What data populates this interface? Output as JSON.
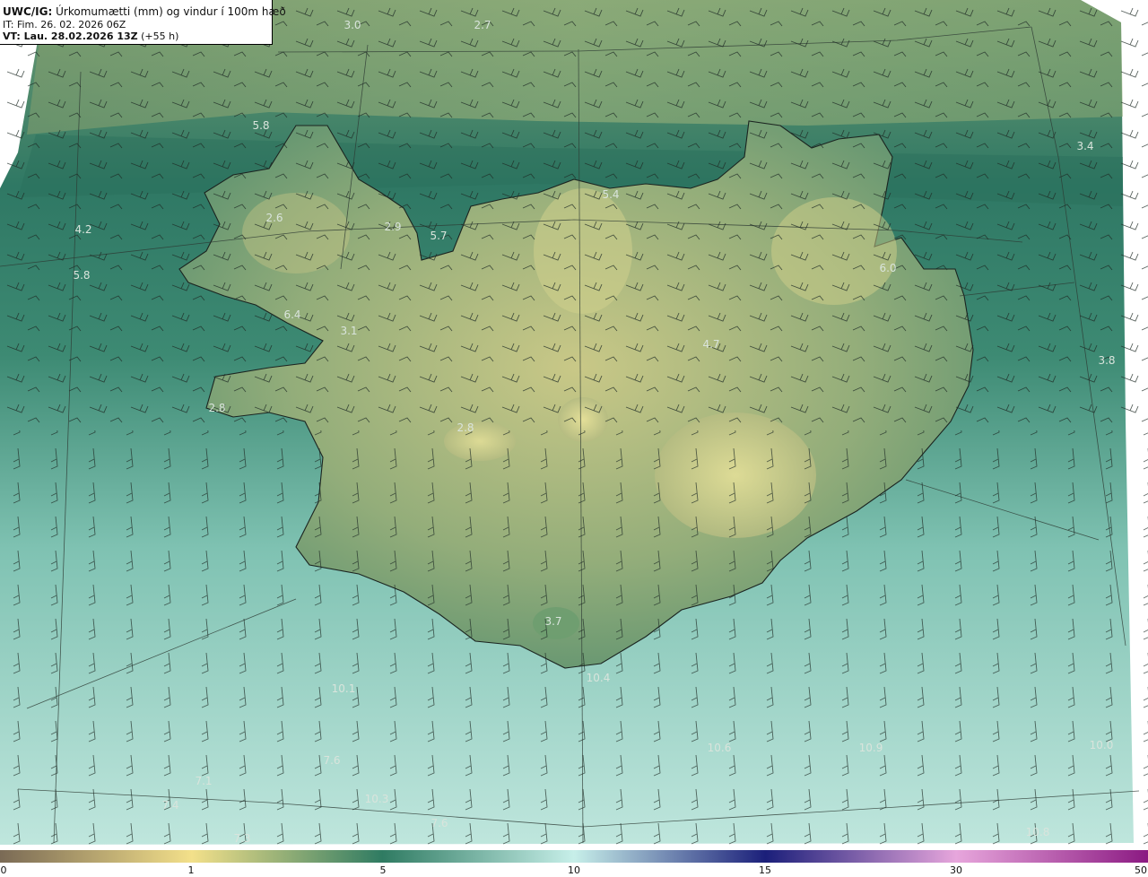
{
  "header": {
    "product_bold": "UWC/IG:",
    "product_rest": "Úrkomumætti (mm) og vindur í 100m hæð",
    "issue_time": "IT: Fim. 26. 02. 2026 06Z",
    "valid_bold": "VT: Lau. 28.02.2026 13Z",
    "valid_rest": "(+55 h)"
  },
  "map": {
    "projection_grid": "on",
    "coastline": "Iceland",
    "value_labels": [
      "3.0",
      "2.7",
      "5.8",
      "3.4",
      "5.4",
      "4.2",
      "2.6",
      "2.9",
      "5.7",
      "5.8",
      "6.0",
      "6.4",
      "3.1",
      "4.7",
      "3.8",
      "2.8",
      "2.8",
      "3.7",
      "10.4",
      "10.1",
      "10.6",
      "10.9",
      "10.0",
      "7.6",
      "7.1",
      "7.4",
      "10.3",
      "7.6",
      "7.3",
      "10.8"
    ],
    "label_color": "#d9e4dc"
  },
  "colorbar": {
    "ticks": [
      "0",
      "1",
      "5",
      "10",
      "15",
      "30",
      "50"
    ],
    "colors": {
      "low": "#7a6a55",
      "dry": "#f3e08a",
      "mid": "#2f7b62",
      "wet": "#c7efe9",
      "high": "#1b1f7a",
      "max": "#8b1a82"
    }
  }
}
